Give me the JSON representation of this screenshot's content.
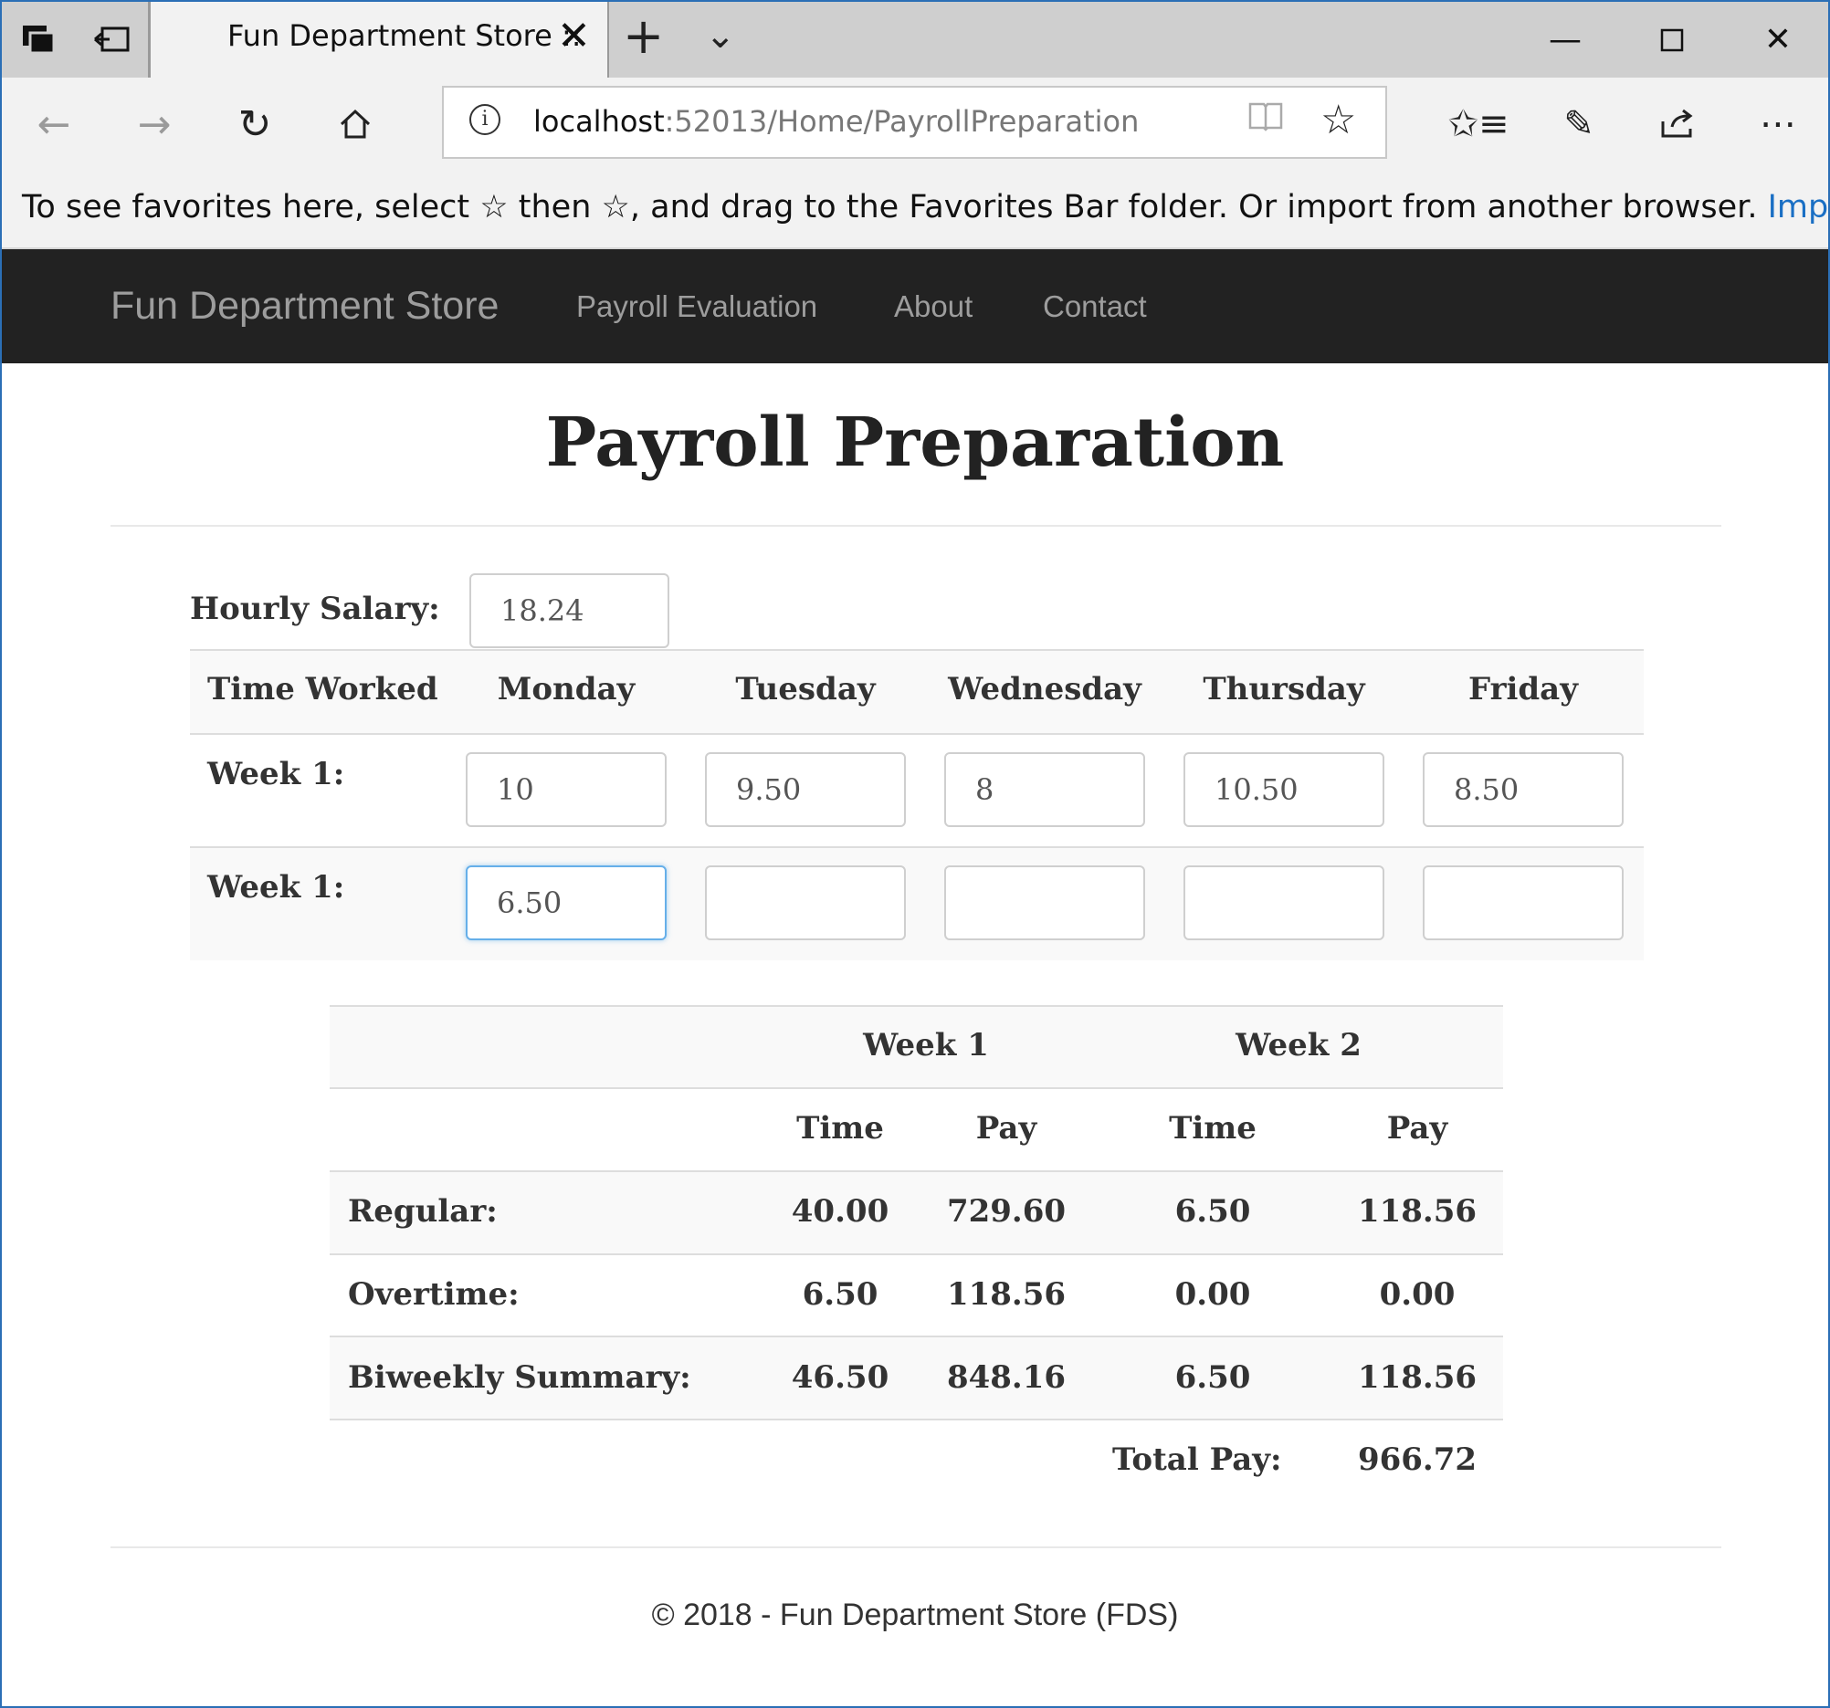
{
  "browser": {
    "tab_title": "Fun Department Store ::",
    "url_host": "localhost",
    "url_path": ":52013/Home/PayrollPreparation",
    "favorites_text": "To see favorites here, select ☆ then ☆, and drag to the Favorites Bar folder. Or import from another browser.",
    "favorites_link": "Import favorites"
  },
  "site": {
    "brand": "Fun Department Store",
    "nav": [
      "Payroll Evaluation",
      "About",
      "Contact"
    ]
  },
  "page": {
    "title": "Payroll Preparation"
  },
  "form": {
    "hourly_label": "Hourly Salary:",
    "hourly_value": "18.24",
    "header_first": "Time Worked",
    "days": [
      "Monday",
      "Tuesday",
      "Wednesday",
      "Thursday",
      "Friday"
    ],
    "rows": [
      {
        "label": "Week 1:",
        "values": [
          "10",
          "9.50",
          "8",
          "10.50",
          "8.50"
        ]
      },
      {
        "label": "Week 1:",
        "values": [
          "6.50",
          "",
          "",
          "",
          ""
        ]
      }
    ]
  },
  "summary": {
    "week_headers": [
      "Week 1",
      "Week 2"
    ],
    "sub_headers": [
      "Time",
      "Pay",
      "Time",
      "Pay"
    ],
    "rows": [
      {
        "label": "Regular:",
        "values": [
          "40.00",
          "729.60",
          "6.50",
          "118.56"
        ]
      },
      {
        "label": "Overtime:",
        "values": [
          "6.50",
          "118.56",
          "0.00",
          "0.00"
        ]
      },
      {
        "label": "Biweekly Summary:",
        "values": [
          "46.50",
          "848.16",
          "6.50",
          "118.56"
        ]
      }
    ],
    "total_label": "Total Pay:",
    "total_value": "966.72"
  },
  "footer": {
    "text": "© 2018 - Fun Department Store (FDS)"
  }
}
